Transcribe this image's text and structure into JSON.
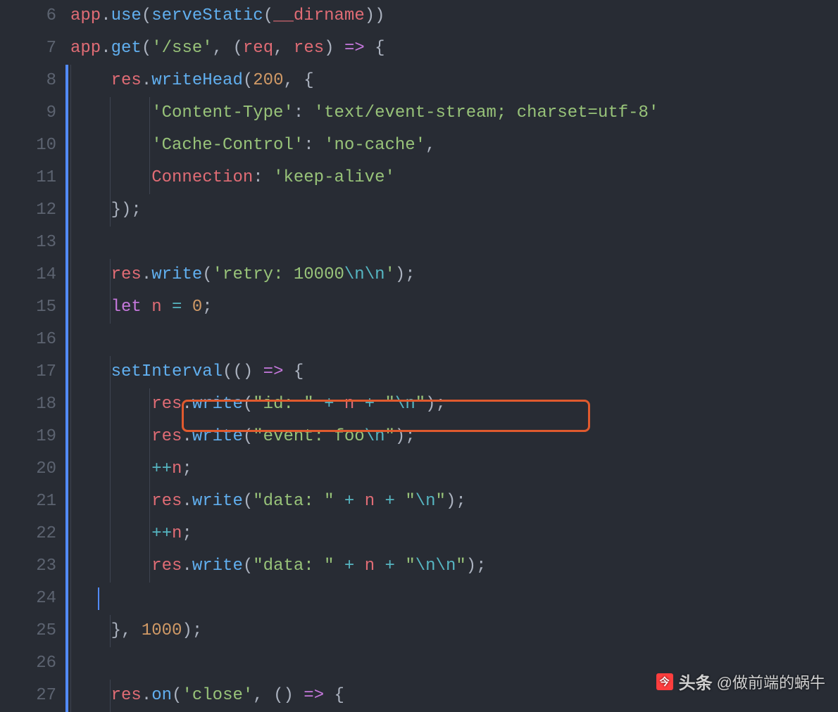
{
  "lines": [
    {
      "num": "6"
    },
    {
      "num": "7"
    },
    {
      "num": "8"
    },
    {
      "num": "9"
    },
    {
      "num": "10"
    },
    {
      "num": "11"
    },
    {
      "num": "12"
    },
    {
      "num": "13"
    },
    {
      "num": "14"
    },
    {
      "num": "15"
    },
    {
      "num": "16"
    },
    {
      "num": "17"
    },
    {
      "num": "18"
    },
    {
      "num": "19"
    },
    {
      "num": "20"
    },
    {
      "num": "21"
    },
    {
      "num": "22"
    },
    {
      "num": "23"
    },
    {
      "num": "24"
    },
    {
      "num": "25"
    },
    {
      "num": "26"
    },
    {
      "num": "27"
    }
  ],
  "code": {
    "l6_app": "app",
    "l6_use": "use",
    "l6_serveStatic": "serveStatic",
    "l6_dirname": "__dirname",
    "l7_app": "app",
    "l7_get": "get",
    "l7_route": "'/sse'",
    "l7_req": "req",
    "l7_res": "res",
    "l8_res": "res",
    "l8_writeHead": "writeHead",
    "l8_200": "200",
    "l9_key": "'Content-Type'",
    "l9_val": "'text/event-stream; charset=utf-8'",
    "l10_key": "'Cache-Control'",
    "l10_val": "'no-cache'",
    "l11_key": "Connection",
    "l11_val": "'keep-alive'",
    "l14_res": "res",
    "l14_write": "write",
    "l14_str_a": "'retry: 10000",
    "l14_esc": "\\n\\n",
    "l14_str_b": "'",
    "l15_let": "let",
    "l15_n": "n",
    "l15_zero": "0",
    "l17_setInterval": "setInterval",
    "l18_res": "res",
    "l18_write": "write",
    "l18_str1a": "\"id: \"",
    "l18_n": "n",
    "l18_str2a": "\"",
    "l18_esc": "\\n",
    "l18_str2b": "\"",
    "l19_res": "res",
    "l19_write": "write",
    "l19_str_a": "\"event: foo",
    "l19_esc": "\\n",
    "l19_str_b": "\"",
    "l20_pp": "++",
    "l20_n": "n",
    "l21_res": "res",
    "l21_write": "write",
    "l21_str1": "\"data: \"",
    "l21_n": "n",
    "l21_str2a": "\"",
    "l21_esc": "\\n",
    "l21_str2b": "\"",
    "l22_pp": "++",
    "l22_n": "n",
    "l23_res": "res",
    "l23_write": "write",
    "l23_str1": "\"data: \"",
    "l23_n": "n",
    "l23_str2a": "\"",
    "l23_esc": "\\n\\n",
    "l23_str2b": "\"",
    "l25_1000": "1000",
    "l27_res": "res",
    "l27_on": "on",
    "l27_close": "'close'"
  },
  "punct": {
    "dot": ".",
    "comma": ", ",
    "comma_trail": ",",
    "open_paren": "(",
    "close_paren": ")",
    "open_brace": "{",
    "close_brace": "}",
    "close_both": "))",
    "semi": ";",
    "arrow": " => ",
    "colon": ": ",
    "colon2": ":  ",
    "eq": " = ",
    "plus": " + ",
    "close_brace_paren_semi": "});",
    "close_brace_comma": "}, ",
    "close_paren_semi": ");"
  },
  "watermark": {
    "bold": "头条",
    "text": "@做前端的蜗牛"
  }
}
